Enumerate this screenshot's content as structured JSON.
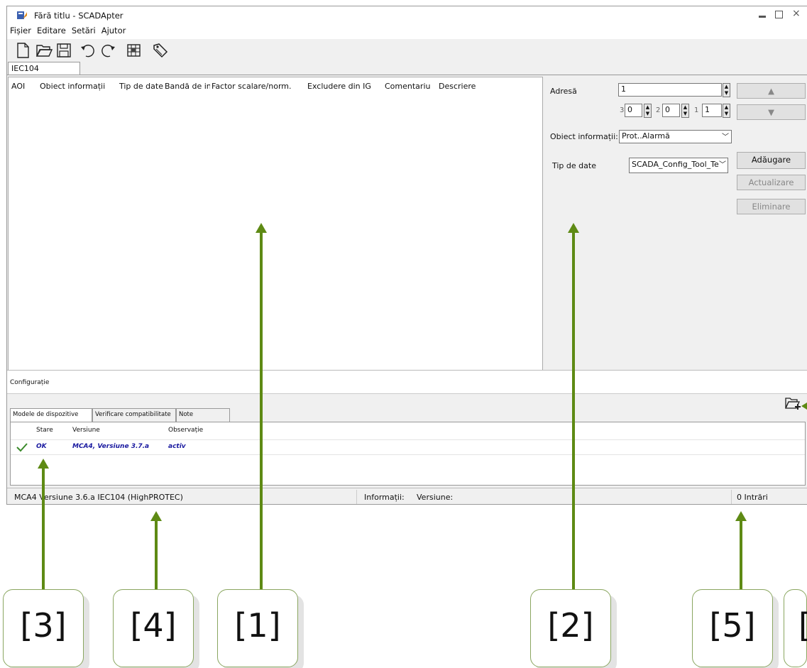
{
  "window": {
    "title": "Fără titlu - SCADApter",
    "controls": [
      "minimize",
      "maximize",
      "close"
    ]
  },
  "menu": [
    "Fișier",
    "Editare",
    "Setări",
    "Ajutor"
  ],
  "toolbar": [
    "new-file-icon",
    "open-folder-icon",
    "save-icon",
    "undo-icon",
    "redo-icon",
    "grid-icon",
    "tag-icon"
  ],
  "tabs": {
    "main": "IEC104"
  },
  "grid": {
    "columns": [
      "AOI",
      "Obiect informații",
      "Tip de date",
      "Bandă de in",
      "Factor scalare/norm.",
      "Excludere din IG",
      "Comentariu",
      "Descriere"
    ]
  },
  "right_panel": {
    "address_label": "Adresă",
    "address_value": "1",
    "sub_labels": [
      "3",
      "2",
      "1"
    ],
    "sub_values": [
      "0",
      "0",
      "1"
    ],
    "info_object_label": "Obiect informații:",
    "info_object_value": "Prot..Alarmă",
    "data_type_label": "Tip de date",
    "data_type_value": "SCADA_Config_Tool_Te",
    "up_arrow": "▲",
    "down_arrow": "▼",
    "add": "Adăugare",
    "update": "Actualizare",
    "delete": "Eliminare"
  },
  "config_label": "Configurație",
  "lower_tabs": [
    "Modele de dispozitive",
    "Verificare compatibilitate",
    "Note"
  ],
  "device_table": {
    "headers": [
      "Stare",
      "Versiune",
      "Observație"
    ],
    "rows": [
      {
        "state": "OK",
        "version": "MCA4, Versiune 3.7.a",
        "note": "activ"
      }
    ]
  },
  "status": {
    "left": "MCA4 Versiune 3.6.a IEC104 (HighPROTEC)",
    "info_label": "Informații:",
    "version_label": "Versiune:",
    "entries": "0 Intrări"
  },
  "callouts": [
    "[3]",
    "[4]",
    "[1]",
    "[2]",
    "[5]",
    "["
  ],
  "colors": {
    "arrow": "#5e8a14",
    "ok_text": "#1a1aa0",
    "ok_check": "#3a8a2a"
  }
}
